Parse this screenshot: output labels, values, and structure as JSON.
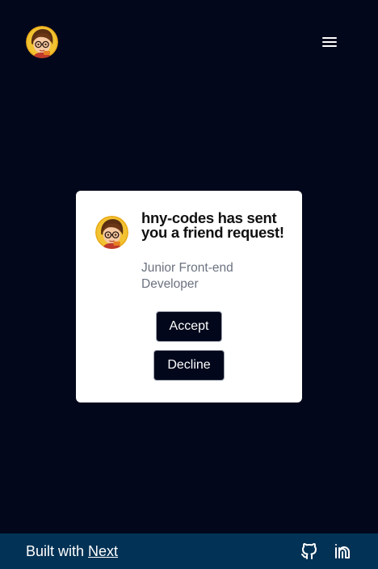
{
  "header": {
    "logo_icon": "avatar-icon",
    "menu_icon": "hamburger-menu-icon"
  },
  "card": {
    "title": "hny-codes has sent you a friend request!",
    "subtitle": "Junior Front-end Developer",
    "accept_label": "Accept",
    "decline_label": "Decline"
  },
  "footer": {
    "built_with_text": "Built with",
    "next_link": "Next",
    "github_icon": "github-icon",
    "linkedin_icon": "linkedin-icon"
  },
  "colors": {
    "background": "#02071b",
    "card": "#ffffff",
    "footer": "#023255",
    "button": "#02071b"
  }
}
